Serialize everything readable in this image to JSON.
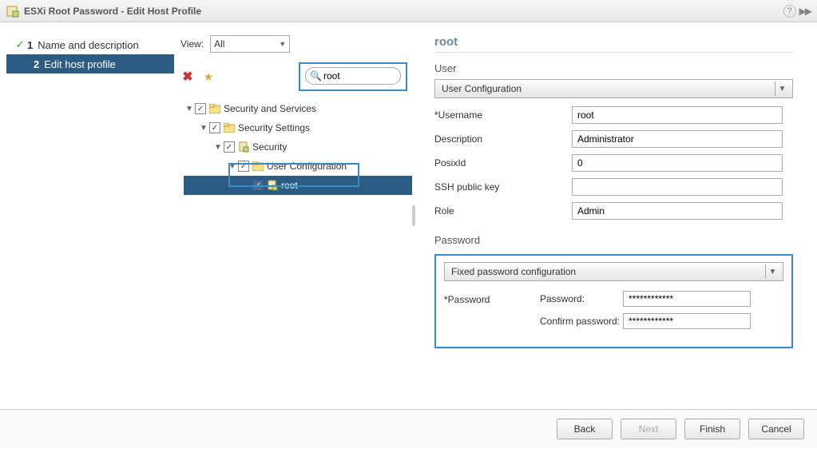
{
  "title": "ESXi Root Password - Edit Host Profile",
  "nav": {
    "step1": {
      "num": "1",
      "label": "Name and description"
    },
    "step2": {
      "num": "2",
      "label": "Edit host profile"
    }
  },
  "view": {
    "label": "View:",
    "selected": "All"
  },
  "search": {
    "value": "root"
  },
  "tree": {
    "n1": "Security and Services",
    "n2": "Security Settings",
    "n3": "Security",
    "n4": "User Configuration",
    "n5": "root"
  },
  "right": {
    "heading": "root",
    "user_section": "User",
    "user_dd": "User Configuration",
    "fields": {
      "username_label": "*Username",
      "username_value": "root",
      "description_label": "Description",
      "description_value": "Administrator",
      "posixid_label": "PosixId",
      "posixid_value": "0",
      "ssh_label": "SSH public key",
      "ssh_value": "",
      "role_label": "Role",
      "role_value": "Admin"
    },
    "password_section": "Password",
    "password_dd": "Fixed password configuration",
    "pw_label": "*Password",
    "pw1_label": "Password:",
    "pw2_label": "Confirm password:",
    "pw_value": "************"
  },
  "footer": {
    "back": "Back",
    "next": "Next",
    "finish": "Finish",
    "cancel": "Cancel"
  }
}
